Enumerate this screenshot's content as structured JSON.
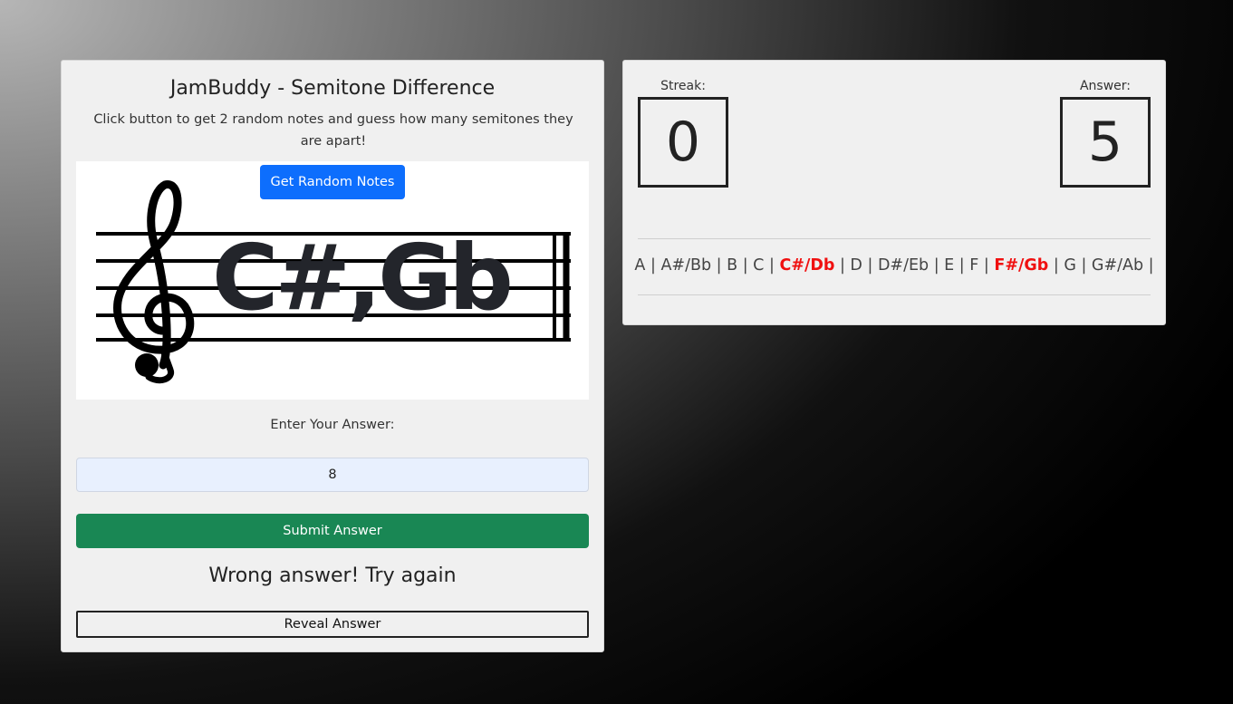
{
  "app": {
    "title": "JamBuddy - Semitone Difference",
    "instructions": "Click button to get 2 random notes and guess how many semitones they are apart!"
  },
  "controls": {
    "random_button_label": "Get Random Notes",
    "displayed_notes": "C#,Gb",
    "answer_label": "Enter Your Answer:",
    "answer_value": "8",
    "submit_label": "Submit Answer",
    "feedback": "Wrong answer! Try again",
    "reveal_label": "Reveal Answer"
  },
  "stats": {
    "streak_label": "Streak:",
    "streak_value": "0",
    "answer_label": "Answer:",
    "answer_value": "5"
  },
  "note_list": {
    "notes": [
      "A",
      "A#/Bb",
      "B",
      "C",
      "C#/Db",
      "D",
      "D#/Eb",
      "E",
      "F",
      "F#/Gb",
      "G",
      "G#/Ab"
    ],
    "highlighted": [
      "C#/Db",
      "F#/Gb"
    ],
    "separator": " | "
  },
  "colors": {
    "primary_button": "#0d6efd",
    "success_button": "#198754",
    "highlight_note": "#f01010",
    "card_background": "#f0f0f0"
  },
  "icons": {
    "staff": "treble-clef-staff-icon"
  }
}
